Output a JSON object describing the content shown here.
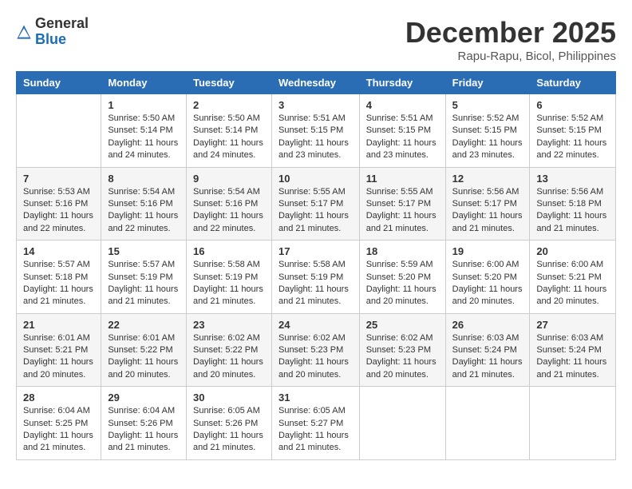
{
  "header": {
    "logo_line1": "General",
    "logo_line2": "Blue",
    "month_year": "December 2025",
    "location": "Rapu-Rapu, Bicol, Philippines"
  },
  "weekdays": [
    "Sunday",
    "Monday",
    "Tuesday",
    "Wednesday",
    "Thursday",
    "Friday",
    "Saturday"
  ],
  "weeks": [
    [
      {
        "day": "",
        "sunrise": "",
        "sunset": "",
        "daylight": ""
      },
      {
        "day": "1",
        "sunrise": "Sunrise: 5:50 AM",
        "sunset": "Sunset: 5:14 PM",
        "daylight": "Daylight: 11 hours and 24 minutes."
      },
      {
        "day": "2",
        "sunrise": "Sunrise: 5:50 AM",
        "sunset": "Sunset: 5:14 PM",
        "daylight": "Daylight: 11 hours and 24 minutes."
      },
      {
        "day": "3",
        "sunrise": "Sunrise: 5:51 AM",
        "sunset": "Sunset: 5:15 PM",
        "daylight": "Daylight: 11 hours and 23 minutes."
      },
      {
        "day": "4",
        "sunrise": "Sunrise: 5:51 AM",
        "sunset": "Sunset: 5:15 PM",
        "daylight": "Daylight: 11 hours and 23 minutes."
      },
      {
        "day": "5",
        "sunrise": "Sunrise: 5:52 AM",
        "sunset": "Sunset: 5:15 PM",
        "daylight": "Daylight: 11 hours and 23 minutes."
      },
      {
        "day": "6",
        "sunrise": "Sunrise: 5:52 AM",
        "sunset": "Sunset: 5:15 PM",
        "daylight": "Daylight: 11 hours and 22 minutes."
      }
    ],
    [
      {
        "day": "7",
        "sunrise": "Sunrise: 5:53 AM",
        "sunset": "Sunset: 5:16 PM",
        "daylight": "Daylight: 11 hours and 22 minutes."
      },
      {
        "day": "8",
        "sunrise": "Sunrise: 5:54 AM",
        "sunset": "Sunset: 5:16 PM",
        "daylight": "Daylight: 11 hours and 22 minutes."
      },
      {
        "day": "9",
        "sunrise": "Sunrise: 5:54 AM",
        "sunset": "Sunset: 5:16 PM",
        "daylight": "Daylight: 11 hours and 22 minutes."
      },
      {
        "day": "10",
        "sunrise": "Sunrise: 5:55 AM",
        "sunset": "Sunset: 5:17 PM",
        "daylight": "Daylight: 11 hours and 21 minutes."
      },
      {
        "day": "11",
        "sunrise": "Sunrise: 5:55 AM",
        "sunset": "Sunset: 5:17 PM",
        "daylight": "Daylight: 11 hours and 21 minutes."
      },
      {
        "day": "12",
        "sunrise": "Sunrise: 5:56 AM",
        "sunset": "Sunset: 5:17 PM",
        "daylight": "Daylight: 11 hours and 21 minutes."
      },
      {
        "day": "13",
        "sunrise": "Sunrise: 5:56 AM",
        "sunset": "Sunset: 5:18 PM",
        "daylight": "Daylight: 11 hours and 21 minutes."
      }
    ],
    [
      {
        "day": "14",
        "sunrise": "Sunrise: 5:57 AM",
        "sunset": "Sunset: 5:18 PM",
        "daylight": "Daylight: 11 hours and 21 minutes."
      },
      {
        "day": "15",
        "sunrise": "Sunrise: 5:57 AM",
        "sunset": "Sunset: 5:19 PM",
        "daylight": "Daylight: 11 hours and 21 minutes."
      },
      {
        "day": "16",
        "sunrise": "Sunrise: 5:58 AM",
        "sunset": "Sunset: 5:19 PM",
        "daylight": "Daylight: 11 hours and 21 minutes."
      },
      {
        "day": "17",
        "sunrise": "Sunrise: 5:58 AM",
        "sunset": "Sunset: 5:19 PM",
        "daylight": "Daylight: 11 hours and 21 minutes."
      },
      {
        "day": "18",
        "sunrise": "Sunrise: 5:59 AM",
        "sunset": "Sunset: 5:20 PM",
        "daylight": "Daylight: 11 hours and 20 minutes."
      },
      {
        "day": "19",
        "sunrise": "Sunrise: 6:00 AM",
        "sunset": "Sunset: 5:20 PM",
        "daylight": "Daylight: 11 hours and 20 minutes."
      },
      {
        "day": "20",
        "sunrise": "Sunrise: 6:00 AM",
        "sunset": "Sunset: 5:21 PM",
        "daylight": "Daylight: 11 hours and 20 minutes."
      }
    ],
    [
      {
        "day": "21",
        "sunrise": "Sunrise: 6:01 AM",
        "sunset": "Sunset: 5:21 PM",
        "daylight": "Daylight: 11 hours and 20 minutes."
      },
      {
        "day": "22",
        "sunrise": "Sunrise: 6:01 AM",
        "sunset": "Sunset: 5:22 PM",
        "daylight": "Daylight: 11 hours and 20 minutes."
      },
      {
        "day": "23",
        "sunrise": "Sunrise: 6:02 AM",
        "sunset": "Sunset: 5:22 PM",
        "daylight": "Daylight: 11 hours and 20 minutes."
      },
      {
        "day": "24",
        "sunrise": "Sunrise: 6:02 AM",
        "sunset": "Sunset: 5:23 PM",
        "daylight": "Daylight: 11 hours and 20 minutes."
      },
      {
        "day": "25",
        "sunrise": "Sunrise: 6:02 AM",
        "sunset": "Sunset: 5:23 PM",
        "daylight": "Daylight: 11 hours and 20 minutes."
      },
      {
        "day": "26",
        "sunrise": "Sunrise: 6:03 AM",
        "sunset": "Sunset: 5:24 PM",
        "daylight": "Daylight: 11 hours and 21 minutes."
      },
      {
        "day": "27",
        "sunrise": "Sunrise: 6:03 AM",
        "sunset": "Sunset: 5:24 PM",
        "daylight": "Daylight: 11 hours and 21 minutes."
      }
    ],
    [
      {
        "day": "28",
        "sunrise": "Sunrise: 6:04 AM",
        "sunset": "Sunset: 5:25 PM",
        "daylight": "Daylight: 11 hours and 21 minutes."
      },
      {
        "day": "29",
        "sunrise": "Sunrise: 6:04 AM",
        "sunset": "Sunset: 5:26 PM",
        "daylight": "Daylight: 11 hours and 21 minutes."
      },
      {
        "day": "30",
        "sunrise": "Sunrise: 6:05 AM",
        "sunset": "Sunset: 5:26 PM",
        "daylight": "Daylight: 11 hours and 21 minutes."
      },
      {
        "day": "31",
        "sunrise": "Sunrise: 6:05 AM",
        "sunset": "Sunset: 5:27 PM",
        "daylight": "Daylight: 11 hours and 21 minutes."
      },
      {
        "day": "",
        "sunrise": "",
        "sunset": "",
        "daylight": ""
      },
      {
        "day": "",
        "sunrise": "",
        "sunset": "",
        "daylight": ""
      },
      {
        "day": "",
        "sunrise": "",
        "sunset": "",
        "daylight": ""
      }
    ]
  ]
}
